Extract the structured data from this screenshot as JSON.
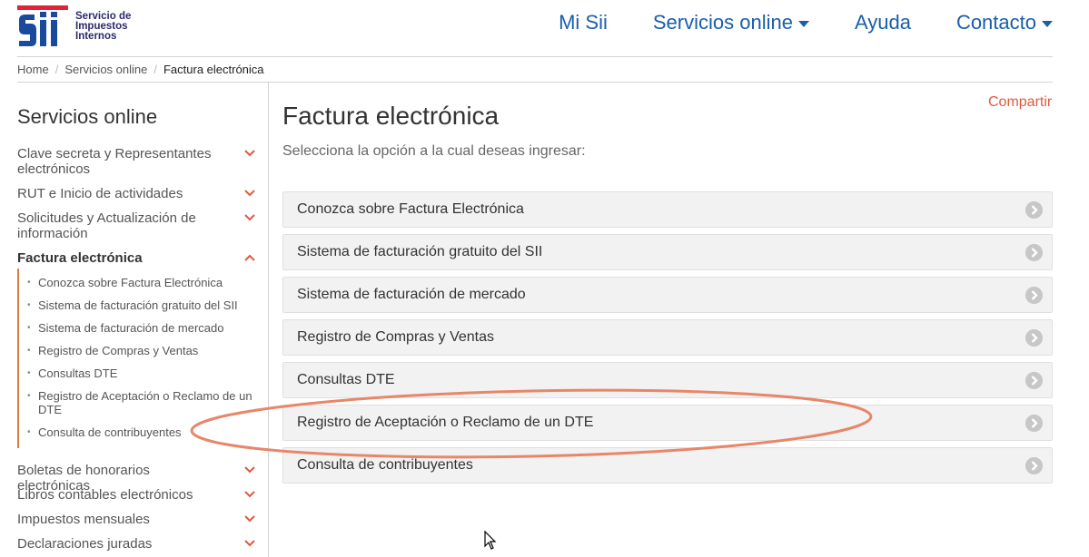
{
  "header": {
    "logo_text_1": "Servicio de",
    "logo_text_2": "Impuestos",
    "logo_text_3": "Internos",
    "nav": [
      {
        "label": "Mi Sii"
      },
      {
        "label": "Servicios online"
      },
      {
        "label": "Ayuda"
      },
      {
        "label": "Contacto"
      }
    ]
  },
  "breadcrumb": {
    "items": [
      "Home",
      "Servicios online",
      "Factura electrónica"
    ],
    "separator": "/"
  },
  "sidebar": {
    "title": "Servicios online",
    "items": [
      {
        "label": "Clave secreta y Representantes electrónicos"
      },
      {
        "label": "RUT e Inicio de actividades"
      },
      {
        "label": "Solicitudes y Actualización de información"
      },
      {
        "label": "Factura electrónica"
      },
      {
        "label": "Boletas de honorarios electrónicas"
      },
      {
        "label": "Libros contables electrónicos"
      },
      {
        "label": "Impuestos mensuales"
      },
      {
        "label": "Declaraciones juradas"
      }
    ],
    "submenu": [
      {
        "label": "Conozca sobre Factura Electrónica"
      },
      {
        "label": "Sistema de facturación gratuito del SII"
      },
      {
        "label": "Sistema de facturación de mercado"
      },
      {
        "label": "Registro de Compras y Ventas"
      },
      {
        "label": "Consultas DTE"
      },
      {
        "label": "Registro de Aceptación o Reclamo de un DTE"
      },
      {
        "label": "Consulta de contribuyentes"
      }
    ]
  },
  "main": {
    "title": "Factura electrónica",
    "share_label": "Compartir",
    "subtitle": "Selecciona la opción a la cual deseas ingresar:",
    "options": [
      {
        "label": "Conozca sobre Factura Electrónica"
      },
      {
        "label": "Sistema de facturación gratuito del SII"
      },
      {
        "label": "Sistema de facturación de mercado"
      },
      {
        "label": "Registro de Compras y Ventas"
      },
      {
        "label": "Consultas DTE"
      },
      {
        "label": "Registro de Aceptación o Reclamo de un DTE"
      },
      {
        "label": "Consulta de contribuyentes"
      }
    ]
  },
  "colors": {
    "brand_blue": "#1a5eab",
    "accent_orange": "#e0593f",
    "annotation": "#e8866a"
  }
}
